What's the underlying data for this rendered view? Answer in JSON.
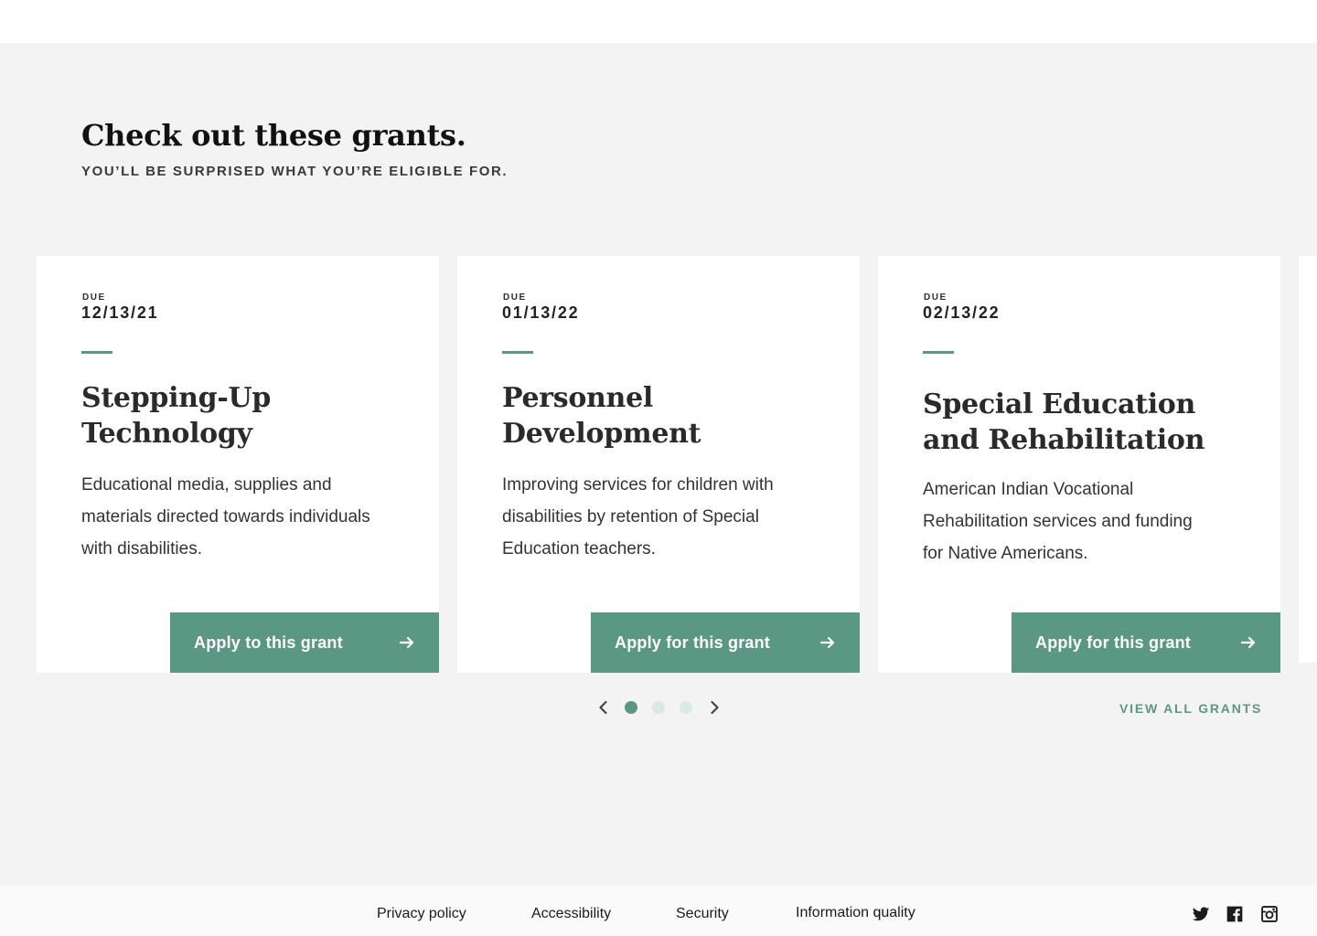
{
  "section": {
    "heading": "Check out these grants.",
    "subheading": "YOU’LL BE SURPRISED WHAT YOU’RE ELIGIBLE FOR."
  },
  "grants": [
    {
      "due_label": "DUE",
      "due_date": "12/13/21",
      "title": "Stepping-Up Technology",
      "description": "Educational media, supplies and materials directed towards individuals with disabilities.",
      "button_label": "Apply to this grant"
    },
    {
      "due_label": "DUE",
      "due_date": "01/13/22",
      "title": "Personnel Development",
      "description": "Improving services for children with disabilities by retention of Special Education teachers.",
      "button_label": "Apply for this grant"
    },
    {
      "due_label": "DUE",
      "due_date": "02/13/22",
      "title": "Special Education and Rehabilitation",
      "description": "American Indian Vocational Rehabilitation services and funding for Native Americans.",
      "button_label": "Apply for this grant"
    }
  ],
  "carousel": {
    "page_count": 3,
    "active_page": 1,
    "prev_icon": "chevron-left-icon",
    "next_icon": "chevron-right-icon",
    "view_all_label": "VIEW ALL GRANTS"
  },
  "footer": {
    "links": [
      "Privacy policy",
      "Accessibility",
      "Security",
      "Information quality"
    ],
    "social_icons": [
      "twitter-icon",
      "facebook-icon",
      "instagram-icon"
    ]
  },
  "colors": {
    "accent": "#5a9884",
    "dot_inactive": "#dbe9e4",
    "section_bg": "#f3f3f3",
    "card_bg": "#ffffff"
  }
}
